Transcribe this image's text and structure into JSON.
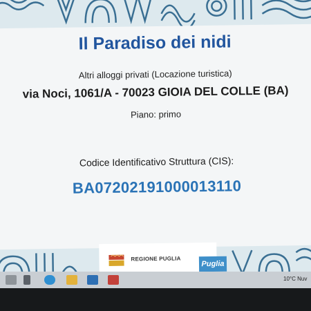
{
  "document": {
    "title": "Il Paradiso dei nidi",
    "subtitle": "Altri alloggi privati (Locazione turistica)",
    "address": "via Noci, 1061/A - 70023 GIOIA DEL COLLE (BA)",
    "floor": "Piano: primo",
    "code_label": "Codice Identificativo Struttura (CIS):",
    "code": "BA07202191000013110"
  },
  "footer": {
    "region_label": "REGIONE PUGLIA",
    "brand_logo": "Puglia"
  },
  "taskbar": {
    "weather": "10°C",
    "weather_extra": "Nuv"
  },
  "colors": {
    "title": "#21559e",
    "code": "#2a73b6",
    "band": "#dde9ee",
    "band_pattern": "#3a6f93"
  }
}
